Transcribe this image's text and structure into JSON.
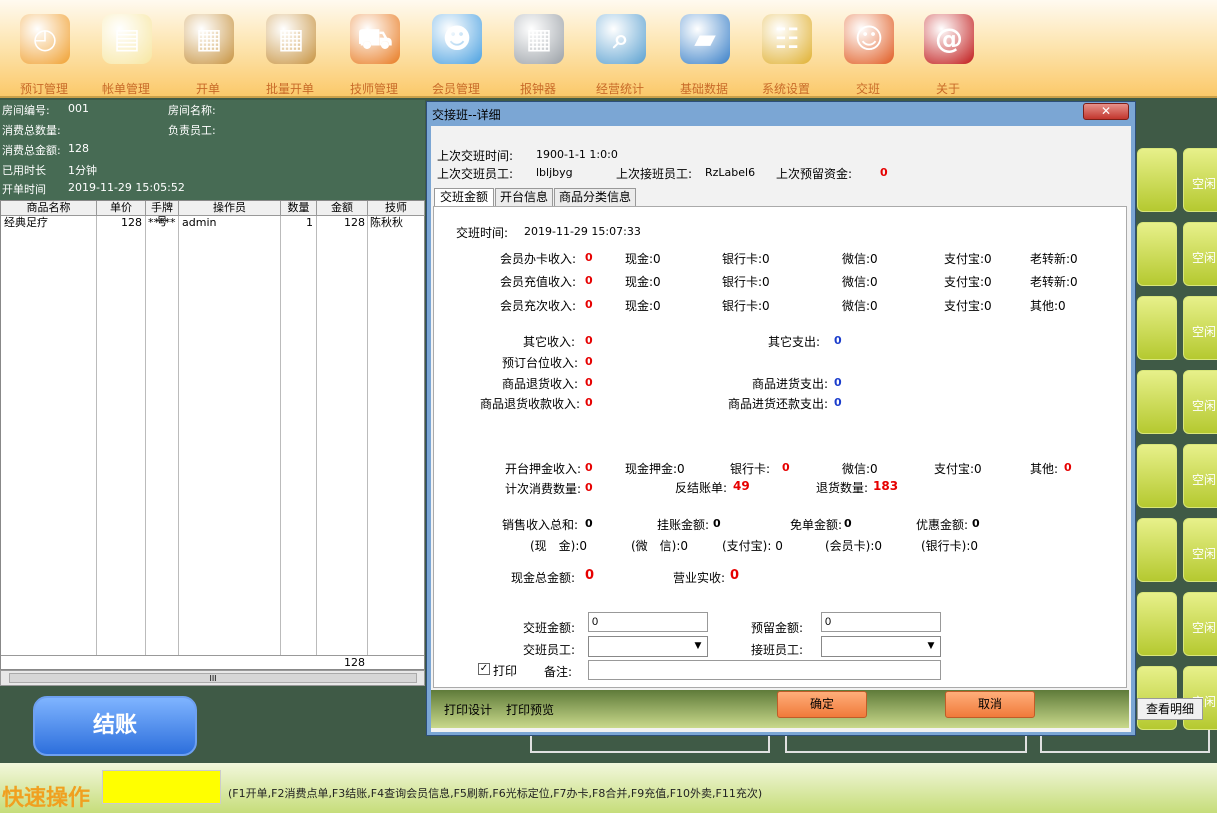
{
  "toolbar": [
    {
      "label": "预订管理",
      "icon": "clock-icon"
    },
    {
      "label": "帐单管理",
      "icon": "notepad-icon"
    },
    {
      "label": "开单",
      "icon": "clipboard-icon"
    },
    {
      "label": "批量开单",
      "icon": "clipboard-icon"
    },
    {
      "label": "技师管理",
      "icon": "cart-icon"
    },
    {
      "label": "会员管理",
      "icon": "users-icon"
    },
    {
      "label": "报钟器",
      "icon": "calculator-icon"
    },
    {
      "label": "经营统计",
      "icon": "search-doc-icon"
    },
    {
      "label": "基础数据",
      "icon": "folder-icon"
    },
    {
      "label": "系统设置",
      "icon": "book-icon"
    },
    {
      "label": "交班",
      "icon": "finder-icon"
    },
    {
      "label": "关于",
      "icon": "at-icon"
    }
  ],
  "left_info": {
    "room_no_label": "房间编号:",
    "room_no": "001",
    "room_name_label": "房间名称:",
    "count_label": "消费总数量:",
    "staff_label": "负责员工:",
    "amount_label": "消费总金额:",
    "amount": "128",
    "used_label": "已用时长",
    "used": "1分钟",
    "open_label": "开单时间",
    "open_time": "2019-11-29 15:05:52"
  },
  "table": {
    "headers": [
      "商品名称",
      "单价",
      "手牌号",
      "操作员",
      "数量",
      "金额",
      "技师"
    ],
    "row": [
      "经典足疗",
      "128",
      "*****",
      "admin",
      "1",
      "128",
      "陈秋秋"
    ],
    "total": "128"
  },
  "checkout_label": "结账",
  "room_status": "空闲",
  "view_detail": "查看明细",
  "quick": {
    "label": "快速操作",
    "shortcuts": "(F1开单,F2消费点单,F3结账,F4查询会员信息,F5刷新,F6光标定位,F7办卡,F8合并,F9充值,F10外卖,F11充次)"
  },
  "dialog": {
    "title": "交接班--详细",
    "close": "✕",
    "last_time_label": "上次交班时间:",
    "last_time": "1900-1-1 1:0:0",
    "last_staff_label": "上次交班员工:",
    "last_staff": "lbljbyg",
    "receiver_label": "上次接班员工:",
    "receiver": "RzLabel6",
    "reserve_label": "上次预留资金:",
    "reserve": "0",
    "tabs": [
      "交班金额",
      "开台信息",
      "商品分类信息"
    ],
    "shift_time_label": "交班时间:",
    "shift_time": "2019-11-29 15:07:33",
    "member_rows": [
      {
        "label": "会员办卡收入:",
        "v": "0",
        "c": "现金:0",
        "b": "银行卡:0",
        "w": "微信:0",
        "z": "支付宝:0",
        "o": "老转新:0"
      },
      {
        "label": "会员充值收入:",
        "v": "0",
        "c": "现金:0",
        "b": "银行卡:0",
        "w": "微信:0",
        "z": "支付宝:0",
        "o": "老转新:0"
      },
      {
        "label": "会员充次收入:",
        "v": "0",
        "c": "现金:0",
        "b": "银行卡:0",
        "w": "微信:0",
        "z": "支付宝:0",
        "o": "其他:0"
      }
    ],
    "other_income_label": "其它收入:",
    "other_income": "0",
    "other_expense_label": "其它支出:",
    "other_expense": "0",
    "reserve_income_label": "预订台位收入:",
    "reserve_income": "0",
    "return_income_label": "商品退货收入:",
    "return_income": "0",
    "purchase_label": "商品进货支出:",
    "purchase": "0",
    "return_collect_label": "商品退货收款收入:",
    "return_collect": "0",
    "purchase_repay_label": "商品进货还款支出:",
    "purchase_repay": "0",
    "deposit_label": "开台押金收入:",
    "deposit": "0",
    "deposit_cash": "现金押金:0",
    "deposit_bank_label": "银行卡:",
    "deposit_bank": "0",
    "deposit_wechat": "微信:0",
    "deposit_alipay": "支付宝:0",
    "deposit_other_label": "其他:",
    "deposit_other": "0",
    "count_label": "计次消费数量:",
    "count": "0",
    "reverse_label": "反结账单:",
    "reverse": "49",
    "return_count_label": "退货数量:",
    "return_count": "183",
    "sales_label": "销售收入总和:",
    "sales": "0",
    "credit_label": "挂账金额:",
    "credit": "0",
    "free_label": "免单金额:",
    "free": "0",
    "discount_label": "优惠金额:",
    "discount": "0",
    "sales_cash": "(现　金):0",
    "sales_wechat": "(微　信):0",
    "sales_alipay": "(支付宝): 0",
    "sales_member": "(会员卡):0",
    "sales_bank": "(银行卡):0",
    "cash_total_label": "现金总金额:",
    "cash_total": "0",
    "actual_label": "营业实收:",
    "actual": "0",
    "shift_amount_label": "交班金额:",
    "shift_amount": "0",
    "keep_amount_label": "预留金额:",
    "keep_amount": "0",
    "shift_staff_label": "交班员工:",
    "receiver_staff_label": "接班员工:",
    "print_label": "打印",
    "note_label": "备注:",
    "print_design": "打印设计",
    "print_preview": "打印预览",
    "ok": "确定",
    "cancel": "取消"
  }
}
